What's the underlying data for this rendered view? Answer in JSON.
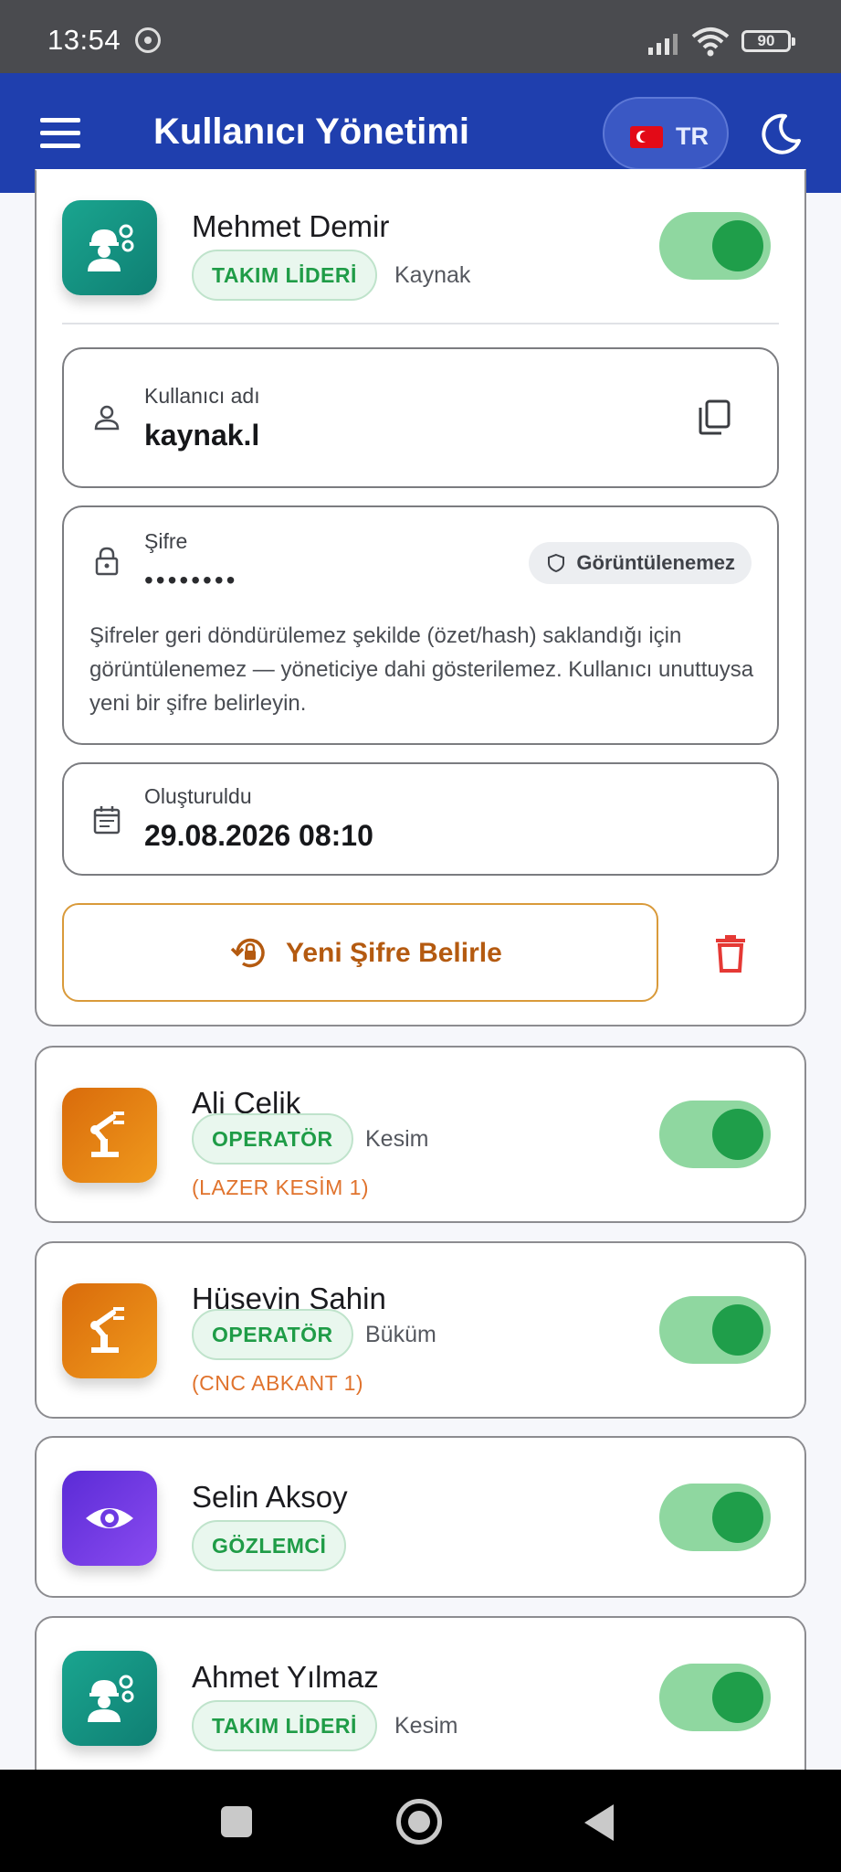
{
  "status_bar": {
    "time": "13:54",
    "battery": "90"
  },
  "app_bar": {
    "title": "Kullanıcı Yönetimi",
    "language": "TR"
  },
  "expanded_user": {
    "name": "Mehmet Demir",
    "role": "TAKIM LİDERİ",
    "department": "Kaynak",
    "active": true,
    "username_label": "Kullanıcı adı",
    "username": "kaynak.l",
    "password_label": "Şifre",
    "password_mask": "••••••••",
    "not_viewable": "Görüntülenemez",
    "password_info": "Şifreler geri döndürülemez şekilde (özet/hash) saklandığı için görüntülenemez — yöneticiye dahi gösterilemez. Kullanıcı unuttuysa yeni bir şifre belirleyin.",
    "created_label": "Oluşturuldu",
    "created_value": "29.08.2026 08:10",
    "reset_button": "Yeni Şifre Belirle"
  },
  "users": [
    {
      "name": "Ali Çelik",
      "role": "OPERATÖR",
      "department": "Kesim",
      "machine": "(LAZER KESİM 1)",
      "active": true,
      "avatar_icon": "robot-arm-icon"
    },
    {
      "name": "Hüseyin Şahin",
      "role": "OPERATÖR",
      "department": "Büküm",
      "machine": "(CNC ABKANT 1)",
      "active": true,
      "avatar_icon": "robot-arm-icon"
    },
    {
      "name": "Selin Aksoy",
      "role": "GÖZLEMCİ",
      "department": "",
      "machine": "",
      "active": true,
      "avatar_icon": "eye-icon"
    },
    {
      "name": "Ahmet Yılmaz",
      "role": "TAKIM LİDERİ",
      "department": "Kesim",
      "machine": "",
      "active": true,
      "avatar_icon": "engineer-icon"
    }
  ],
  "colors": {
    "app_bar": "#1f3fae",
    "active_toggle": "#1f9e4a",
    "role_badge": "#1f9c47",
    "reset_button": "#b45a10",
    "delete_icon": "#e53935"
  }
}
